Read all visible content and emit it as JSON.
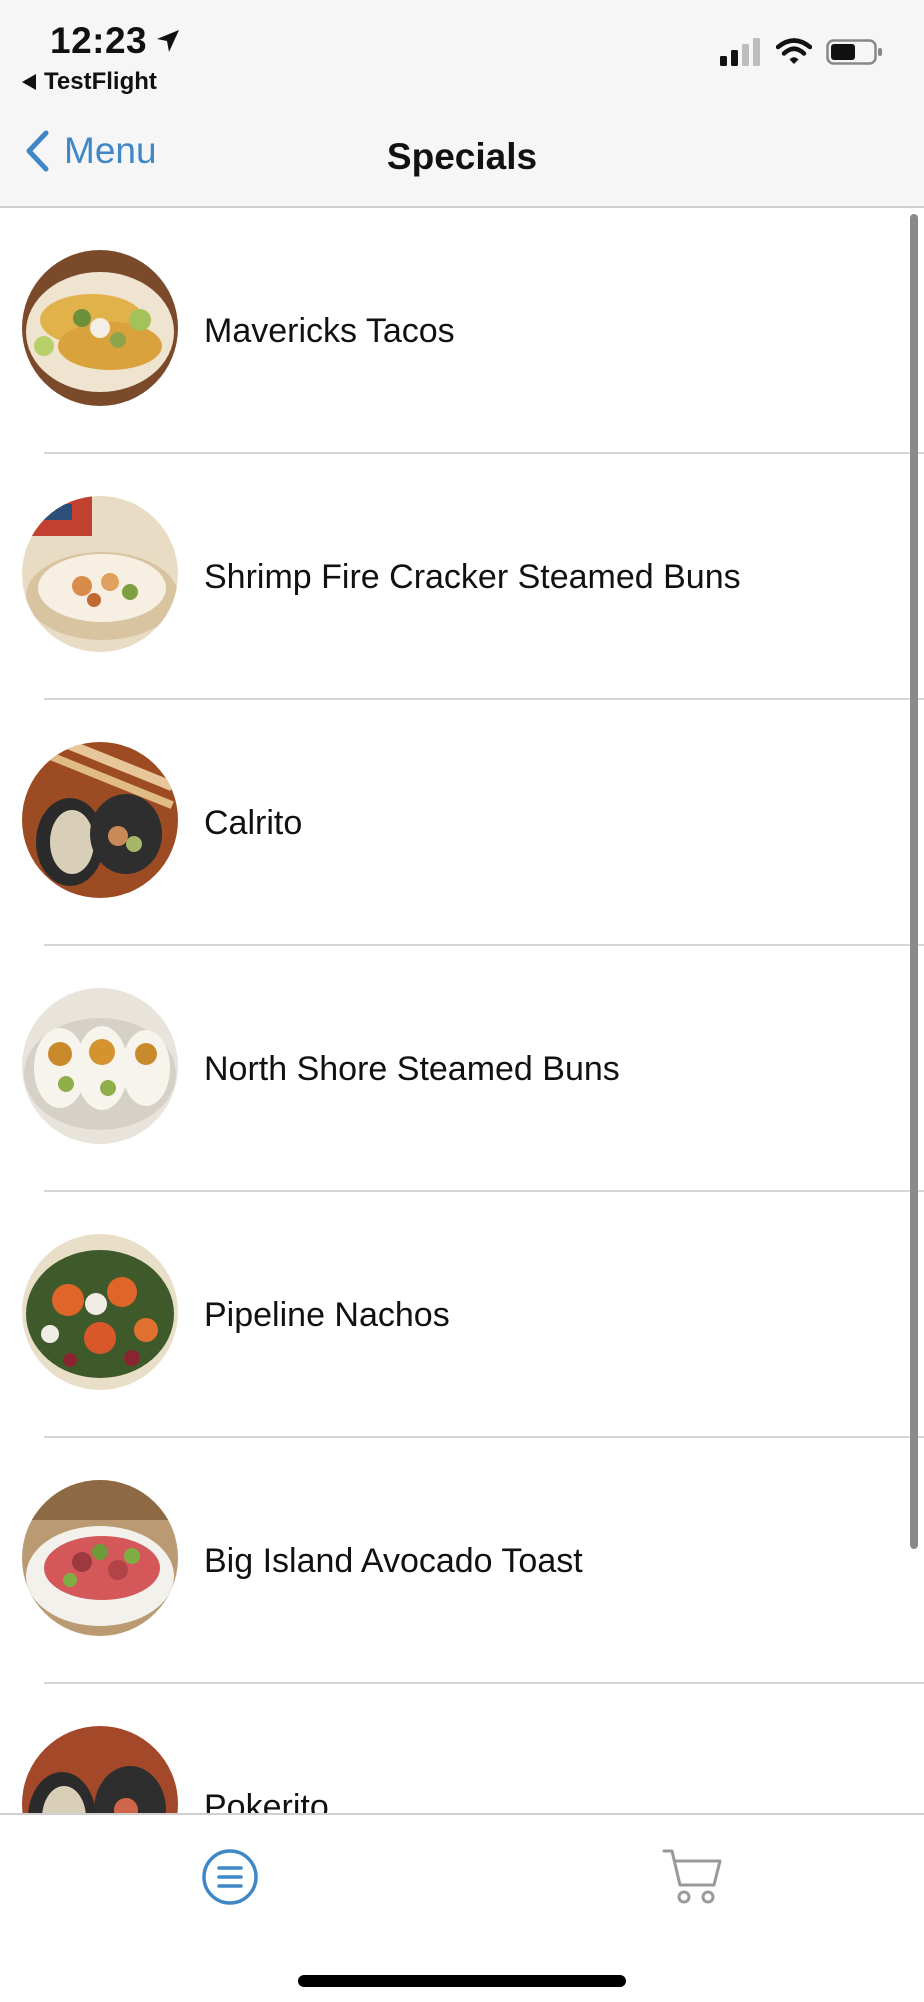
{
  "status_bar": {
    "time": "12:23",
    "back_app": "TestFlight"
  },
  "nav": {
    "back_label": "Menu",
    "title": "Specials"
  },
  "colors": {
    "accent": "#3f87c5"
  },
  "items": [
    {
      "name": "Mavericks Tacos"
    },
    {
      "name": "Shrimp Fire Cracker Steamed Buns"
    },
    {
      "name": "Calrito"
    },
    {
      "name": "North Shore Steamed Buns"
    },
    {
      "name": "Pipeline Nachos"
    },
    {
      "name": "Big Island Avocado Toast"
    },
    {
      "name": "Pokerito"
    }
  ],
  "tab_bar": {
    "icons": [
      "menu-list-icon",
      "cart-icon"
    ]
  }
}
